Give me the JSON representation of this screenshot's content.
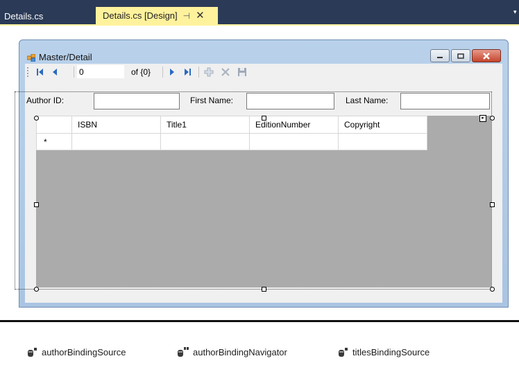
{
  "tabs": [
    {
      "label": "Details.cs"
    },
    {
      "label": "Details.cs [Design]",
      "pin": "⊣",
      "close": "✕"
    }
  ],
  "form": {
    "title": "Master/Detail"
  },
  "navigator": {
    "position": "0",
    "count_label": "of {0}"
  },
  "fields": {
    "author_id_label": "Author ID:",
    "first_name_label": "First Name:",
    "last_name_label": "Last Name:",
    "author_id_value": "",
    "first_name_value": "",
    "last_name_value": ""
  },
  "grid": {
    "columns": [
      "ISBN",
      "Title1",
      "EditionNumber",
      "Copyright"
    ],
    "new_row_marker": "*"
  },
  "tray": {
    "items": [
      {
        "label": "authorBindingSource",
        "icon": "binding-source-icon"
      },
      {
        "label": "authorBindingNavigator",
        "icon": "binding-navigator-icon"
      },
      {
        "label": "titlesBindingSource",
        "icon": "binding-source-icon"
      }
    ]
  },
  "colors": {
    "tab_bar": "#2B3A56",
    "active_tab": "#FFF29D",
    "form_frame": "#B9D1EA",
    "grid_background": "#ABABAB",
    "close_button": "#C4452C"
  }
}
